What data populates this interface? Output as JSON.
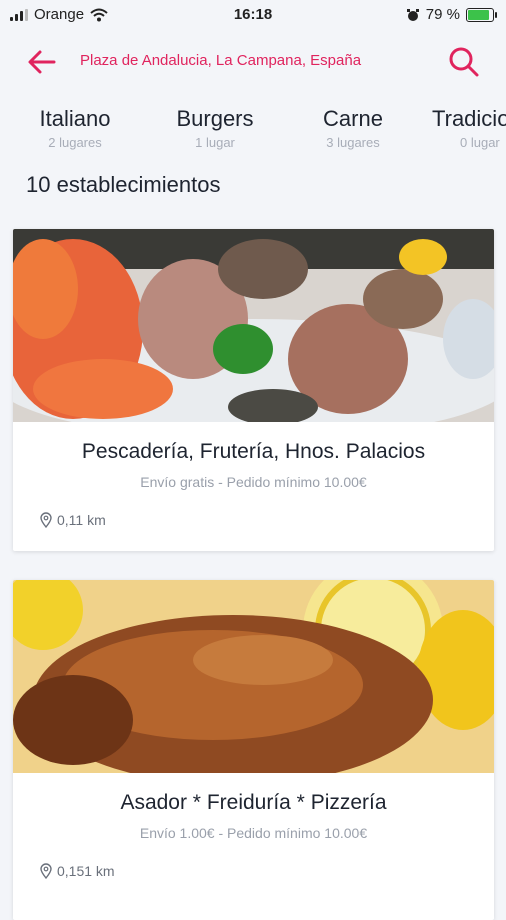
{
  "status": {
    "carrier": "Orange",
    "time": "16:18",
    "battery": "79 %",
    "battery_level": 0.79
  },
  "header": {
    "location": "Plaza de Andalucia, La Campana, España"
  },
  "categories": [
    {
      "name": "Italiano",
      "count": "2 lugares"
    },
    {
      "name": "Burgers",
      "count": "1 lugar"
    },
    {
      "name": "Carne",
      "count": "3 lugares"
    },
    {
      "name": "Tradicio",
      "count": "0 lugar"
    }
  ],
  "list": {
    "count_title": "10 establecimientos",
    "items": [
      {
        "title": "Pescadería, Frutería,  Hnos. Palacios",
        "subtitle": "Envío gratis - Pedido mínimo 10.00€",
        "distance": "0,11 km"
      },
      {
        "title": "Asador * Freiduría * Pizzería",
        "subtitle": "Envío 1.00€ - Pedido mínimo 10.00€",
        "distance": "0,151 km"
      }
    ]
  },
  "colors": {
    "accent": "#e0245e",
    "background": "#f3f5f9"
  }
}
